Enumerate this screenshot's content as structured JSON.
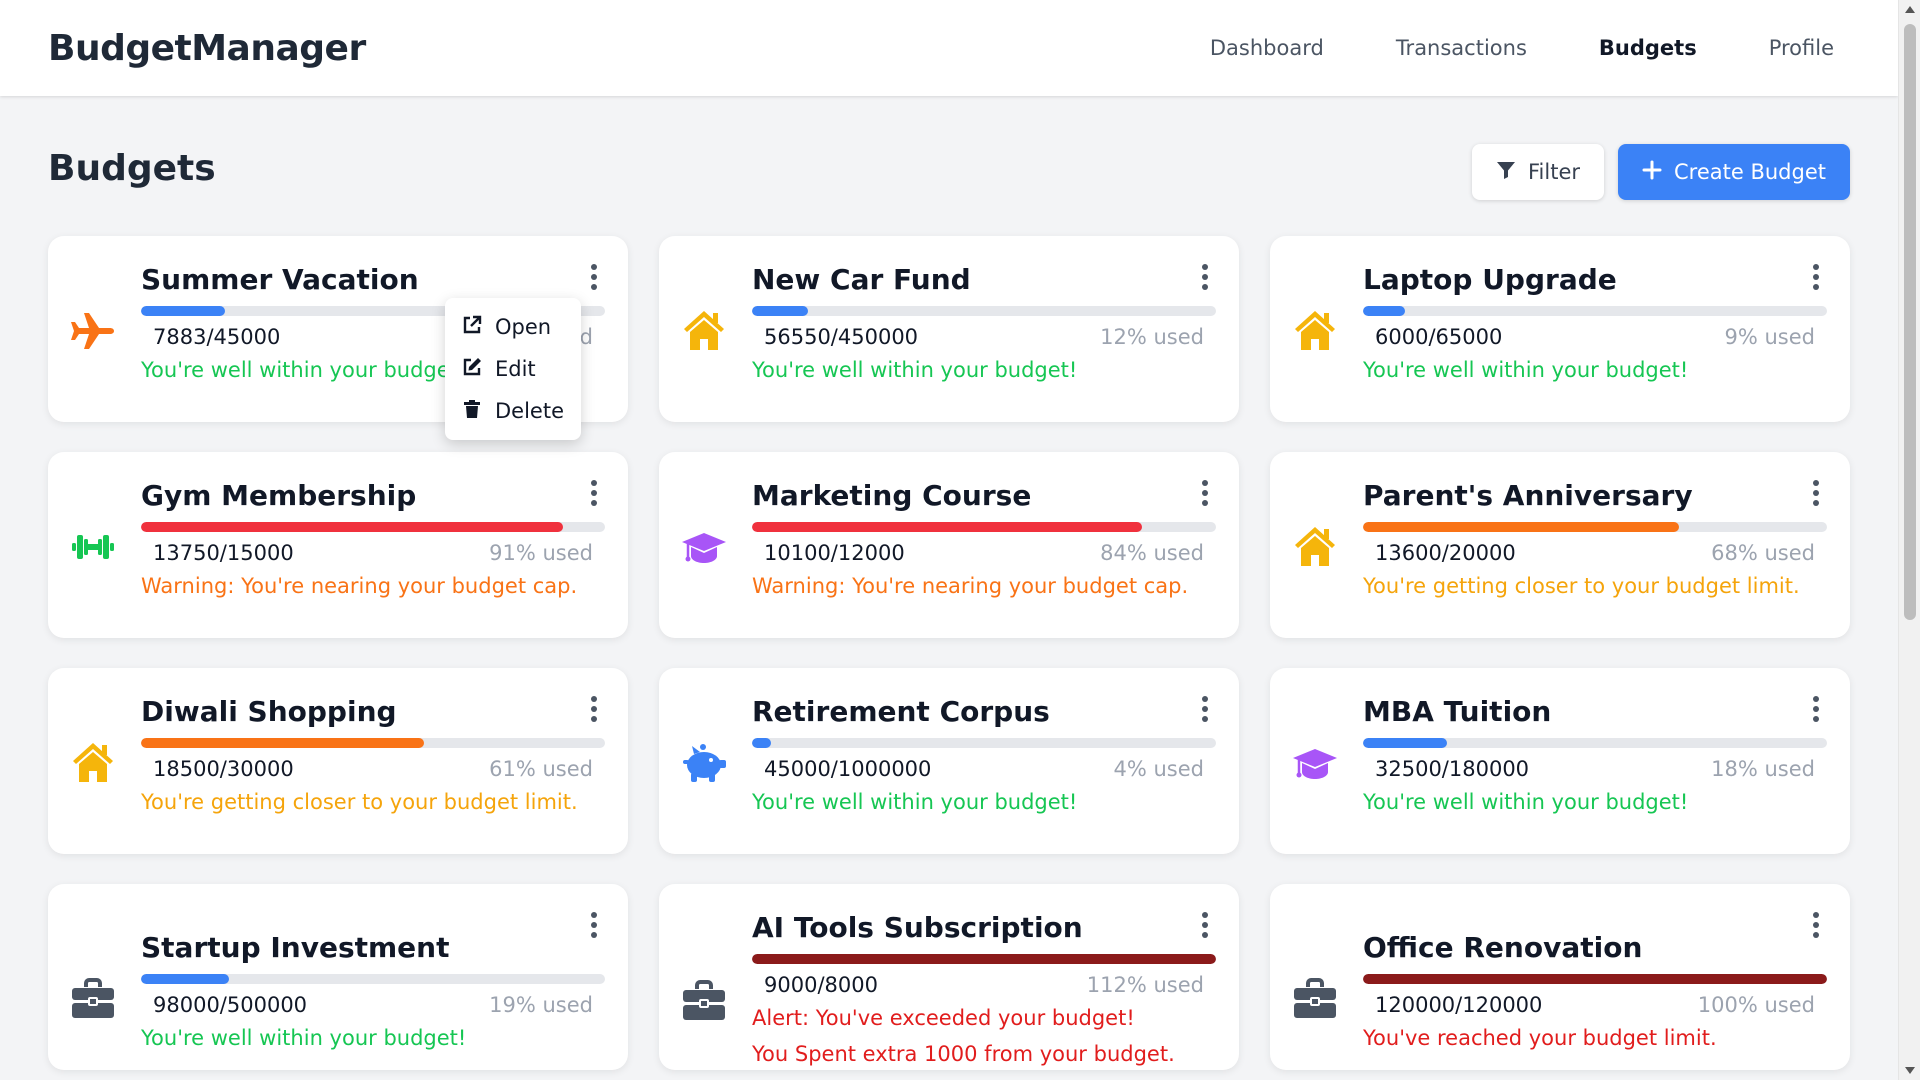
{
  "app": {
    "brand": "BudgetManager"
  },
  "nav": [
    {
      "label": "Dashboard",
      "active": false
    },
    {
      "label": "Transactions",
      "active": false
    },
    {
      "label": "Budgets",
      "active": true
    },
    {
      "label": "Profile",
      "active": false
    }
  ],
  "page": {
    "title": "Budgets",
    "filter_label": "Filter",
    "create_label": "Create Budget"
  },
  "context_menu": {
    "open": "Open",
    "edit": "Edit",
    "delete": "Delete"
  },
  "colors": {
    "blue": "#3b82f6",
    "red": "#f0313d",
    "orange": "#f97316",
    "dark_red": "#8b1a1a",
    "green": "#16c653",
    "warn_orange": "#f97316",
    "amber": "#f5a40b",
    "alert_red": "#e11d1d"
  },
  "budgets": [
    {
      "name": "Summer Vacation",
      "icon": "plane-icon",
      "icon_color": "#f97316",
      "spent": "7883/45000",
      "used": "18% used",
      "progress": 0.18,
      "bar_color": "#3b82f6",
      "status": "You're well within your budget!",
      "status_color": "#16c653",
      "status2": "",
      "menu_open": true
    },
    {
      "name": "New Car Fund",
      "icon": "home-icon",
      "icon_color": "#f5b50b",
      "spent": "56550/450000",
      "used": "12% used",
      "progress": 0.12,
      "bar_color": "#3b82f6",
      "status": "You're well within your budget!",
      "status_color": "#16c653",
      "status2": ""
    },
    {
      "name": "Laptop Upgrade",
      "icon": "home-icon",
      "icon_color": "#f5b50b",
      "spent": "6000/65000",
      "used": "9% used",
      "progress": 0.09,
      "bar_color": "#3b82f6",
      "status": "You're well within your budget!",
      "status_color": "#16c653",
      "status2": ""
    },
    {
      "name": "Gym Membership",
      "icon": "dumbbell-icon",
      "icon_color": "#16c653",
      "spent": "13750/15000",
      "used": "91% used",
      "progress": 0.91,
      "bar_color": "#f0313d",
      "status": "Warning: You're nearing your budget cap.",
      "status_color": "#f97316",
      "status2": ""
    },
    {
      "name": "Marketing Course",
      "icon": "graduation-cap-icon",
      "icon_color": "#a855f7",
      "spent": "10100/12000",
      "used": "84% used",
      "progress": 0.84,
      "bar_color": "#f0313d",
      "status": "Warning: You're nearing your budget cap.",
      "status_color": "#f97316",
      "status2": ""
    },
    {
      "name": "Parent's Anniversary",
      "icon": "home-icon",
      "icon_color": "#f5b50b",
      "spent": "13600/20000",
      "used": "68% used",
      "progress": 0.68,
      "bar_color": "#f97316",
      "status": "You're getting closer to your budget limit.",
      "status_color": "#f5a40b",
      "status2": ""
    },
    {
      "name": "Diwali Shopping",
      "icon": "home-icon",
      "icon_color": "#f5b50b",
      "spent": "18500/30000",
      "used": "61% used",
      "progress": 0.61,
      "bar_color": "#f97316",
      "status": "You're getting closer to your budget limit.",
      "status_color": "#f5a40b",
      "status2": ""
    },
    {
      "name": "Retirement Corpus",
      "icon": "piggy-bank-icon",
      "icon_color": "#3b82f6",
      "spent": "45000/1000000",
      "used": "4% used",
      "progress": 0.04,
      "bar_color": "#3b82f6",
      "status": "You're well within your budget!",
      "status_color": "#16c653",
      "status2": ""
    },
    {
      "name": "MBA Tuition",
      "icon": "graduation-cap-icon",
      "icon_color": "#a855f7",
      "spent": "32500/180000",
      "used": "18% used",
      "progress": 0.18,
      "bar_color": "#3b82f6",
      "status": "You're well within your budget!",
      "status_color": "#16c653",
      "status2": ""
    },
    {
      "name": "Startup Investment",
      "icon": "briefcase-icon",
      "icon_color": "#4b5563",
      "spent": "98000/500000",
      "used": "19% used",
      "progress": 0.19,
      "bar_color": "#3b82f6",
      "status": "You're well within your budget!",
      "status_color": "#16c653",
      "status2": ""
    },
    {
      "name": "AI Tools Subscription",
      "icon": "briefcase-icon",
      "icon_color": "#4b5563",
      "spent": "9000/8000",
      "used": "112% used",
      "progress": 1.0,
      "bar_color": "#8b1a1a",
      "status": "Alert: You've exceeded your budget!",
      "status_color": "#e11d1d",
      "status2": "You Spent extra 1000 from your budget."
    },
    {
      "name": "Office Renovation",
      "icon": "briefcase-icon",
      "icon_color": "#4b5563",
      "spent": "120000/120000",
      "used": "100% used",
      "progress": 1.0,
      "bar_color": "#8b1a1a",
      "status": "You've reached your budget limit.",
      "status_color": "#e11d1d",
      "status2": ""
    }
  ]
}
